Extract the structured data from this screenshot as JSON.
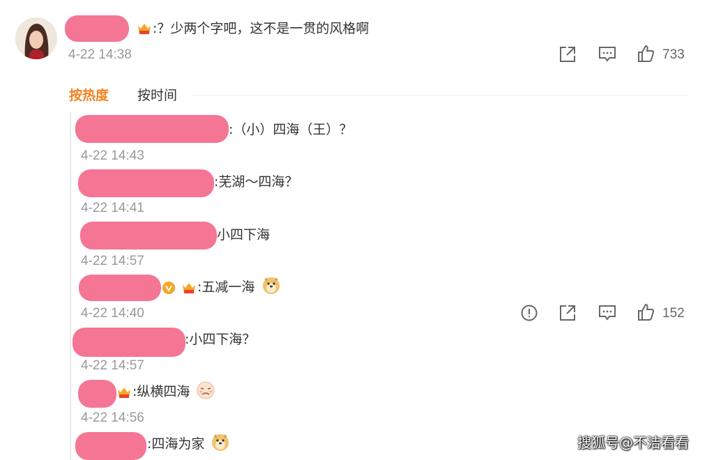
{
  "top_comment": {
    "text": ":？少两个字吧，这不是一贯的风格啊",
    "time": "4-22 14:38",
    "likes": "733"
  },
  "tabs": {
    "hot": "按热度",
    "time": "按时间"
  },
  "replies": [
    {
      "text": ":（小）四海（王）？",
      "time": "4-22 14:43"
    },
    {
      "text": ":芜湖～四海？",
      "time": "4-22 14:41"
    },
    {
      "text": "小四下海",
      "time": "4-22 14:57"
    },
    {
      "text": ":五减一海",
      "time": "4-22 14:40",
      "likes": "152"
    },
    {
      "text": ":小四下海？",
      "time": "4-22 14:57"
    },
    {
      "text": ":纵横四海",
      "time": "4-22 14:56"
    },
    {
      "text": ":四海为家",
      "time": ""
    }
  ],
  "watermark": "搜狐号@不洁看看",
  "colors": {
    "accent": "#f58220",
    "redaction": "#f57594",
    "muted": "#999999"
  },
  "icons": [
    "share-icon",
    "comment-icon",
    "like-icon",
    "report-icon",
    "crown-badge-icon",
    "verified-icon",
    "doge-emoji",
    "sad-face-emoji"
  ]
}
